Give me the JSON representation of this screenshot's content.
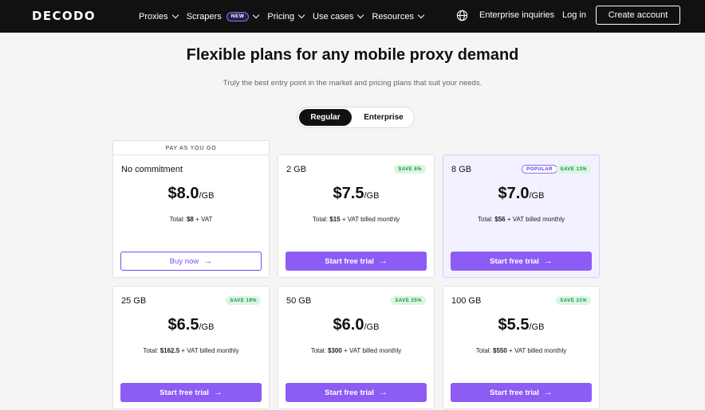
{
  "nav": {
    "logo": "DECODO",
    "items": [
      {
        "label": "Proxies"
      },
      {
        "label": "Scrapers",
        "badge": "NEW"
      },
      {
        "label": "Pricing"
      },
      {
        "label": "Use cases"
      },
      {
        "label": "Resources"
      }
    ],
    "globe_icon": "globe-icon",
    "enterprise": "Enterprise inquiries",
    "login": "Log in",
    "create": "Create account"
  },
  "hero": {
    "title": "Flexible plans for any mobile proxy demand",
    "subtitle": "Truly the best entry point in the market and pricing plans that suit your needs."
  },
  "toggle": {
    "regular": "Regular",
    "enterprise": "Enterprise",
    "selected": "Regular"
  },
  "paygo_label": "PAY AS YOU GO",
  "plans": [
    {
      "name": "No commitment",
      "save": "",
      "popular": "",
      "price": "$8.0",
      "unit": "/GB",
      "total_prefix": "Total: ",
      "total_value": "$8",
      "total_suffix": " + VAT",
      "button": "Buy now",
      "button_style": "outline"
    },
    {
      "name": "2 GB",
      "save": "SAVE 6%",
      "popular": "",
      "price": "$7.5",
      "unit": "/GB",
      "total_prefix": "Total: ",
      "total_value": "$15",
      "total_suffix": " + VAT billed monthly",
      "button": "Start free trial",
      "button_style": "fill"
    },
    {
      "name": "8 GB",
      "save": "SAVE 13%",
      "popular": "POPULAR",
      "price": "$7.0",
      "unit": "/GB",
      "total_prefix": "Total: ",
      "total_value": "$56",
      "total_suffix": " + VAT billed monthly",
      "button": "Start free trial",
      "button_style": "fill"
    },
    {
      "name": "25 GB",
      "save": "SAVE 19%",
      "popular": "",
      "price": "$6.5",
      "unit": "/GB",
      "total_prefix": "Total: ",
      "total_value": "$162.5",
      "total_suffix": " + VAT billed monthly",
      "button": "Start free trial",
      "button_style": "fill"
    },
    {
      "name": "50 GB",
      "save": "SAVE 25%",
      "popular": "",
      "price": "$6.0",
      "unit": "/GB",
      "total_prefix": "Total: ",
      "total_value": "$300",
      "total_suffix": " + VAT billed monthly",
      "button": "Start free trial",
      "button_style": "fill"
    },
    {
      "name": "100 GB",
      "save": "SAVE 31%",
      "popular": "",
      "price": "$5.5",
      "unit": "/GB",
      "total_prefix": "Total: ",
      "total_value": "$550",
      "total_suffix": " + VAT billed monthly",
      "button": "Start free trial",
      "button_style": "fill"
    }
  ],
  "colors": {
    "accent": "#8c5cf5",
    "nav_bg": "#111111",
    "save_bg": "#d9f6e0",
    "save_text": "#17914a",
    "popular_card_bg": "#f3f1ff"
  }
}
